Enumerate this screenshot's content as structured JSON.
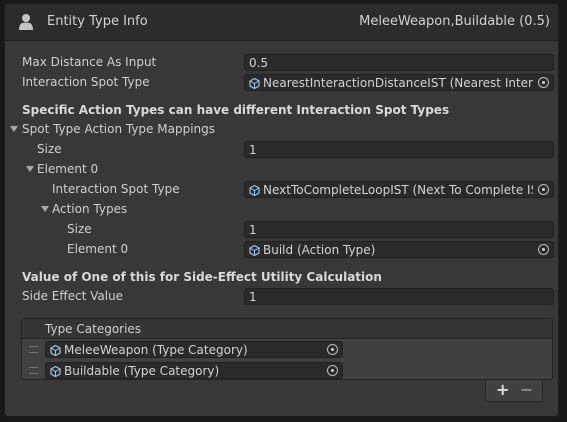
{
  "header": {
    "title": "Entity Type Info",
    "subtitle": "MeleeWeapon,Buildable (0.5)",
    "icon": "person-icon"
  },
  "fields": {
    "max_distance_label": "Max Distance As Input",
    "max_distance_value": "0.5",
    "spot_type_label": "Interaction Spot Type",
    "spot_type_value": "NearestInteractionDistanceIST (Nearest Interactio"
  },
  "mapping_section": {
    "heading": "Specific Action Types can have different Interaction Spot Types",
    "foldout_label": "Spot Type Action Type Mappings",
    "size_label": "Size",
    "size_value": "1",
    "element_label": "Element 0",
    "element_spot_label": "Interaction Spot Type",
    "element_spot_value": "NextToCompleteLoopIST (Next To Complete IST)",
    "action_types_label": "Action Types",
    "action_size_label": "Size",
    "action_size_value": "1",
    "action_element_label": "Element 0",
    "action_element_value": "Build (Action Type)"
  },
  "side_effect": {
    "heading": "Value of One of this for Side-Effect Utility Calculation",
    "label": "Side Effect Value",
    "value": "1"
  },
  "type_categories": {
    "header": "Type Categories",
    "items": [
      {
        "label": "MeleeWeapon (Type Category)"
      },
      {
        "label": "Buildable (Type Category)"
      }
    ],
    "add_label": "+",
    "remove_label": "−"
  },
  "colors": {
    "background": "#383838",
    "header_bg": "#2c2c2c",
    "field_bg": "#2a2a2a",
    "text": "#d2d2d2"
  }
}
